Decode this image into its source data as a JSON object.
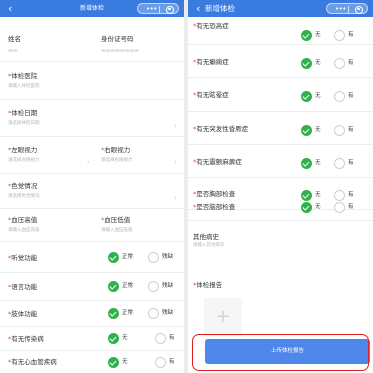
{
  "left_screen": {
    "navbar": {
      "back": "‹",
      "title": "新增体检",
      "capsule_dots": "•••"
    },
    "fields": {
      "name_label": "姓名",
      "name_value": "▬▬",
      "id_label": "身份证号码",
      "id_value": "▬▬▬▬▬▬▬▬",
      "hospital": {
        "star": "*",
        "label": "体检医院",
        "placeholder": "请输入体检医院"
      },
      "date": {
        "star": "*",
        "label": "体检日期",
        "placeholder": "请选择体检日期"
      },
      "left_vision": {
        "star": "*",
        "label": "左眼视力",
        "placeholder": "请选择左眼视力"
      },
      "right_vision": {
        "star": "*",
        "label": "右眼视力",
        "placeholder": "请选择右眼视力"
      },
      "color_vision": {
        "star": "*",
        "label": "色觉情况",
        "placeholder": "请选择色觉情况"
      },
      "bp_high": {
        "star": "*",
        "label": "血压高值",
        "placeholder": "请输入血压高值"
      },
      "bp_low": {
        "star": "*",
        "label": "血压低值",
        "placeholder": "请输入血压低值"
      }
    },
    "radio_rows": [
      {
        "star": "*",
        "label": "听觉功能",
        "opt1": "正常",
        "opt2": "残缺"
      },
      {
        "star": "*",
        "label": "语言功能",
        "opt1": "正常",
        "opt2": "残缺"
      },
      {
        "star": "*",
        "label": "肢体功能",
        "opt1": "正常",
        "opt2": "残缺"
      },
      {
        "star": "*",
        "label": "有无传染病",
        "opt1": "无",
        "opt2": "有"
      },
      {
        "star": "*",
        "label": "有无心血管疾病",
        "opt1": "无",
        "opt2": "有"
      }
    ]
  },
  "right_screen": {
    "navbar": {
      "back": "‹",
      "title": "新增体检",
      "capsule_dots": "•••"
    },
    "radio_rows": [
      {
        "star": "*",
        "label": "有无恐高症",
        "opt1": "无",
        "opt2": "有"
      },
      {
        "star": "*",
        "label": "有无癫痫症",
        "opt1": "无",
        "opt2": "有"
      },
      {
        "star": "*",
        "label": "有无眩晕症",
        "opt1": "无",
        "opt2": "有"
      },
      {
        "star": "*",
        "label": "有无突发性昏厥症",
        "opt1": "无",
        "opt2": "有"
      },
      {
        "star": "*",
        "label": "有无震颤麻痹症",
        "opt1": "无",
        "opt2": "有"
      },
      {
        "star": "*",
        "label": "是否胸部检查",
        "opt1": "无",
        "opt2": "有"
      },
      {
        "star": "*",
        "label": "是否脑部检查",
        "opt1": "无",
        "opt2": "有"
      }
    ],
    "other_history": {
      "label": "其他病史",
      "placeholder": "请输入其他病史"
    },
    "report": {
      "star": "*",
      "label": "体检报告",
      "add_symbol": "+"
    },
    "upload_button": "上传体检报告"
  },
  "colors": {
    "nav": "#3a7be0",
    "checked": "#2fb24c",
    "button": "#4e86ea",
    "highlight": "#e02020",
    "required": "#e84e3c"
  }
}
